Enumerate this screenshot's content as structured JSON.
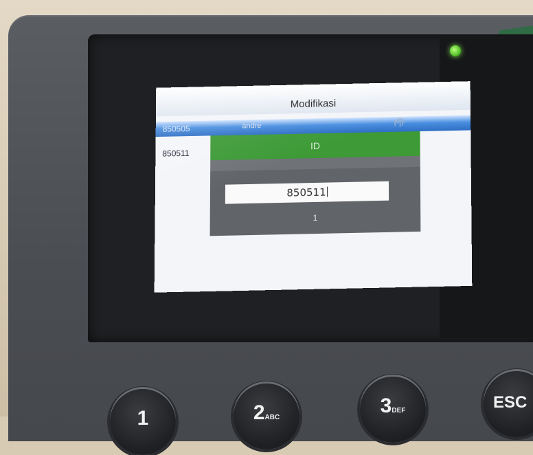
{
  "screen": {
    "title": "Modifikasi",
    "rows": [
      {
        "id": "850505",
        "name": "andre",
        "icon": "fingerprint-icon",
        "selected": true
      },
      {
        "id": "850511",
        "name": "",
        "icon": "fingerprint-icon",
        "selected": false
      }
    ]
  },
  "dialog": {
    "title": "ID",
    "input_value": "850511",
    "count": "1"
  },
  "keypad": {
    "key1": {
      "main": "1",
      "sub": ""
    },
    "key2": {
      "main": "2",
      "sub": "ABC"
    },
    "key3": {
      "main": "3",
      "sub": "DEF"
    },
    "esc": {
      "main": "ESC"
    }
  },
  "colors": {
    "dialog_header": "#3d9a36",
    "selected_row": "#2f6fc4",
    "led": "#55c229"
  }
}
